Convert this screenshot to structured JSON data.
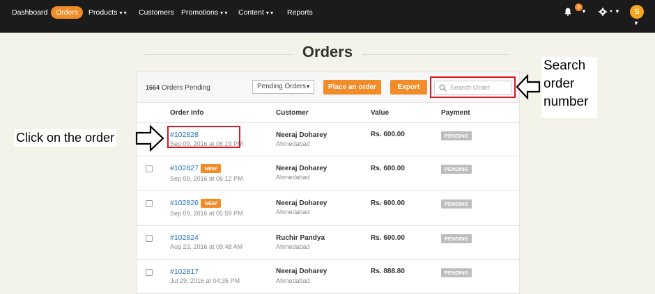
{
  "nav": {
    "items": [
      {
        "label": "Dashboard",
        "caret": ""
      },
      {
        "label": "Orders",
        "caret": ""
      },
      {
        "label": "Products",
        "caret": "▾ ▾"
      },
      {
        "label": "Customers",
        "caret": ""
      },
      {
        "label": "Promotions",
        "caret": "▾ ▾"
      },
      {
        "label": "Content",
        "caret": "▾ ▾"
      },
      {
        "label": "Reports",
        "caret": ""
      }
    ],
    "notification_count": "5",
    "avatar_letter": "S",
    "icons": [
      "bell-icon",
      "gear-icon"
    ],
    "accent": "#f28c28"
  },
  "page": {
    "title": "Orders"
  },
  "toolbar": {
    "pending_number": "1664",
    "pending_label": "Orders Pending",
    "filter_value": "Pending Orders",
    "place_order_label": "Place an order",
    "export_label": "Export",
    "search_placeholder": "Search Order"
  },
  "table": {
    "headers": [
      "Order Info",
      "Customer",
      "Value",
      "Payment"
    ],
    "rows": [
      {
        "order": "#102828",
        "date": "Sep 09, 2016 at 06:19 PM",
        "badge": "",
        "customer": "Neeraj Doharey",
        "city": "Ahmedabad",
        "value": "Rs. 600.00",
        "payment": "PENDING"
      },
      {
        "order": "#102827",
        "date": "Sep 09, 2016 at 06:12 PM",
        "badge": "NEW",
        "customer": "Neeraj Doharey",
        "city": "Ahmedabad",
        "value": "Rs. 600.00",
        "payment": "PENDING"
      },
      {
        "order": "#102826",
        "date": "Sep 09, 2016 at 05:59 PM",
        "badge": "NEW",
        "customer": "Neeraj Doharey",
        "city": "Ahmedabad",
        "value": "Rs. 600.00",
        "payment": "PENDING"
      },
      {
        "order": "#102824",
        "date": "Aug 23, 2016 at 09:48 AM",
        "badge": "",
        "customer": "Ruchir Pandya",
        "city": "Ahmedabad",
        "value": "Rs. 600.00",
        "payment": "PENDING"
      },
      {
        "order": "#102817",
        "date": "Jul 29, 2016 at 04:35 PM",
        "badge": "",
        "customer": "Neeraj Doharey",
        "city": "Ahmedabad",
        "value": "Rs. 888.80",
        "payment": "PENDING"
      }
    ]
  },
  "annotations": {
    "left_text": "Click on the order",
    "right_text": "Search order number",
    "highlight_color": "#e0141e"
  }
}
